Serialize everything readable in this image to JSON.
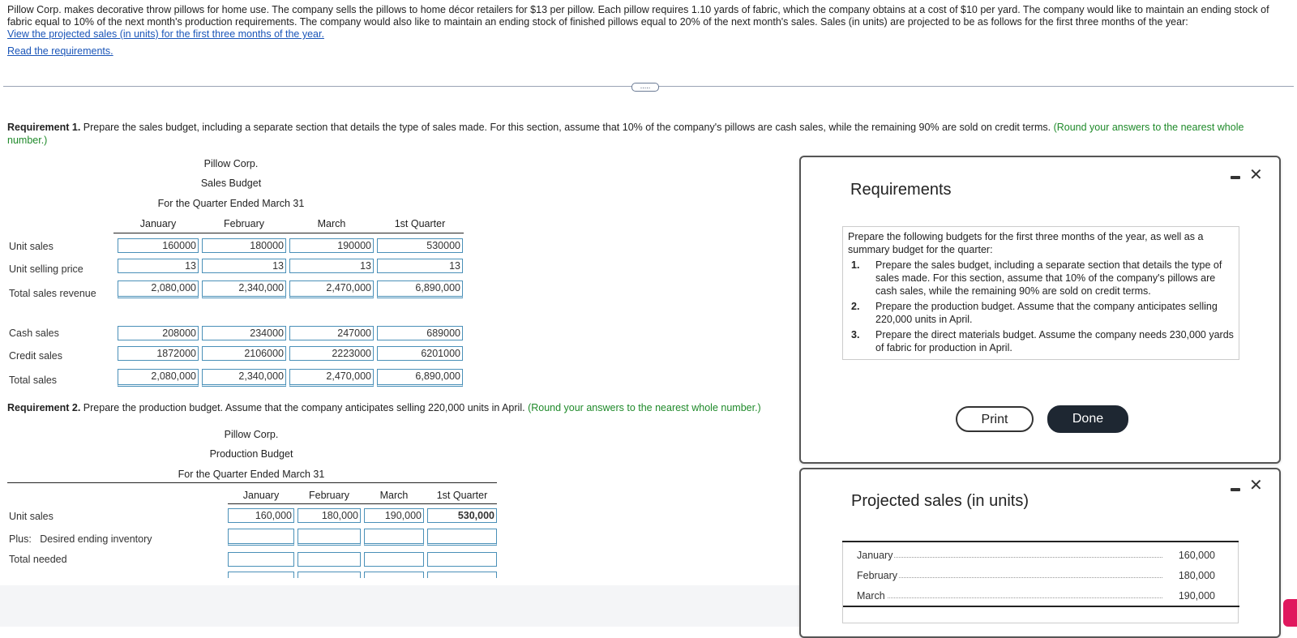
{
  "intro": {
    "text": "Pillow Corp. makes decorative throw pillows for home use. The company sells the pillows to home décor retailers for $13 per pillow. Each pillow requires 1.10 yards of fabric, which the company obtains at a cost of $10 per yard. The company would like to maintain an ending stock of fabric equal to 10% of the next month's production requirements. The company would also like to maintain an ending stock of finished pillows equal to 20% of the next month's sales. Sales (in units) are projected to be as follows for the first three months of the year:",
    "link_projected": "View the projected sales (in units) for the first three months of the year.",
    "link_requirements": "Read the requirements.",
    "more_button": "....."
  },
  "req1": {
    "label": "Requirement 1.",
    "text": " Prepare the sales budget, including a separate section that details the type of sales made. For this section, assume that 10% of the company's pillows are cash sales, while the remaining 90% are sold on credit terms.",
    "hint": "(Round your answers to the nearest whole number.)"
  },
  "sales_budget": {
    "company": "Pillow Corp.",
    "title": "Sales Budget",
    "period": "For the Quarter Ended March 31",
    "columns": [
      "January",
      "February",
      "March",
      "1st Quarter"
    ],
    "rows": [
      {
        "label": "Unit sales",
        "values": [
          "160000",
          "180000",
          "190000",
          "530000"
        ]
      },
      {
        "label": "Unit selling price",
        "values": [
          "13",
          "13",
          "13",
          "13"
        ]
      },
      {
        "label": "Total sales revenue",
        "values": [
          "2,080,000",
          "2,340,000",
          "2,470,000",
          "6,890,000"
        ]
      },
      {
        "label": "Cash sales",
        "values": [
          "208000",
          "234000",
          "247000",
          "689000"
        ]
      },
      {
        "label": "Credit sales",
        "values": [
          "1872000",
          "2106000",
          "2223000",
          "6201000"
        ]
      },
      {
        "label": "Total sales",
        "values": [
          "2,080,000",
          "2,340,000",
          "2,470,000",
          "6,890,000"
        ]
      }
    ]
  },
  "req2": {
    "label": "Requirement 2.",
    "text": " Prepare the production budget. Assume that the company anticipates selling 220,000 units in April.",
    "hint": "(Round your answers to the nearest whole number.)"
  },
  "production_budget": {
    "company": "Pillow Corp.",
    "title": "Production Budget",
    "period": "For the Quarter Ended March 31",
    "columns": [
      "January",
      "February",
      "March",
      "1st Quarter"
    ],
    "rows": [
      {
        "label": "Unit sales",
        "values": [
          "160,000",
          "180,000",
          "190,000",
          "530,000"
        ]
      },
      {
        "prefix": "Plus:",
        "label": "Desired ending inventory",
        "values": [
          "",
          "",
          "",
          ""
        ]
      },
      {
        "label": "Total needed",
        "values": [
          "",
          "",
          "",
          ""
        ]
      }
    ]
  },
  "requirements_modal": {
    "title": "Requirements",
    "intro": "Prepare the following budgets for the first three months of the year, as well as a summary budget for the quarter:",
    "items": [
      {
        "num": "1.",
        "text": "Prepare the sales budget, including a separate section that details the type of sales made. For this section, assume that 10% of the company's pillows are cash sales, while the remaining 90% are sold on credit terms."
      },
      {
        "num": "2.",
        "text": "Prepare the production budget. Assume that the company anticipates selling 220,000 units in April."
      },
      {
        "num": "3.",
        "text": "Prepare the direct materials budget. Assume the company needs 230,000 yards of fabric for production in April."
      }
    ],
    "print_label": "Print",
    "done_label": "Done",
    "close_glyph": "✕"
  },
  "projected_modal": {
    "title": "Projected sales (in units)",
    "close_glyph": "✕",
    "rows": [
      {
        "month": "January",
        "value": "160,000"
      },
      {
        "month": "February",
        "value": "180,000"
      },
      {
        "month": "March",
        "value": "190,000"
      }
    ]
  }
}
